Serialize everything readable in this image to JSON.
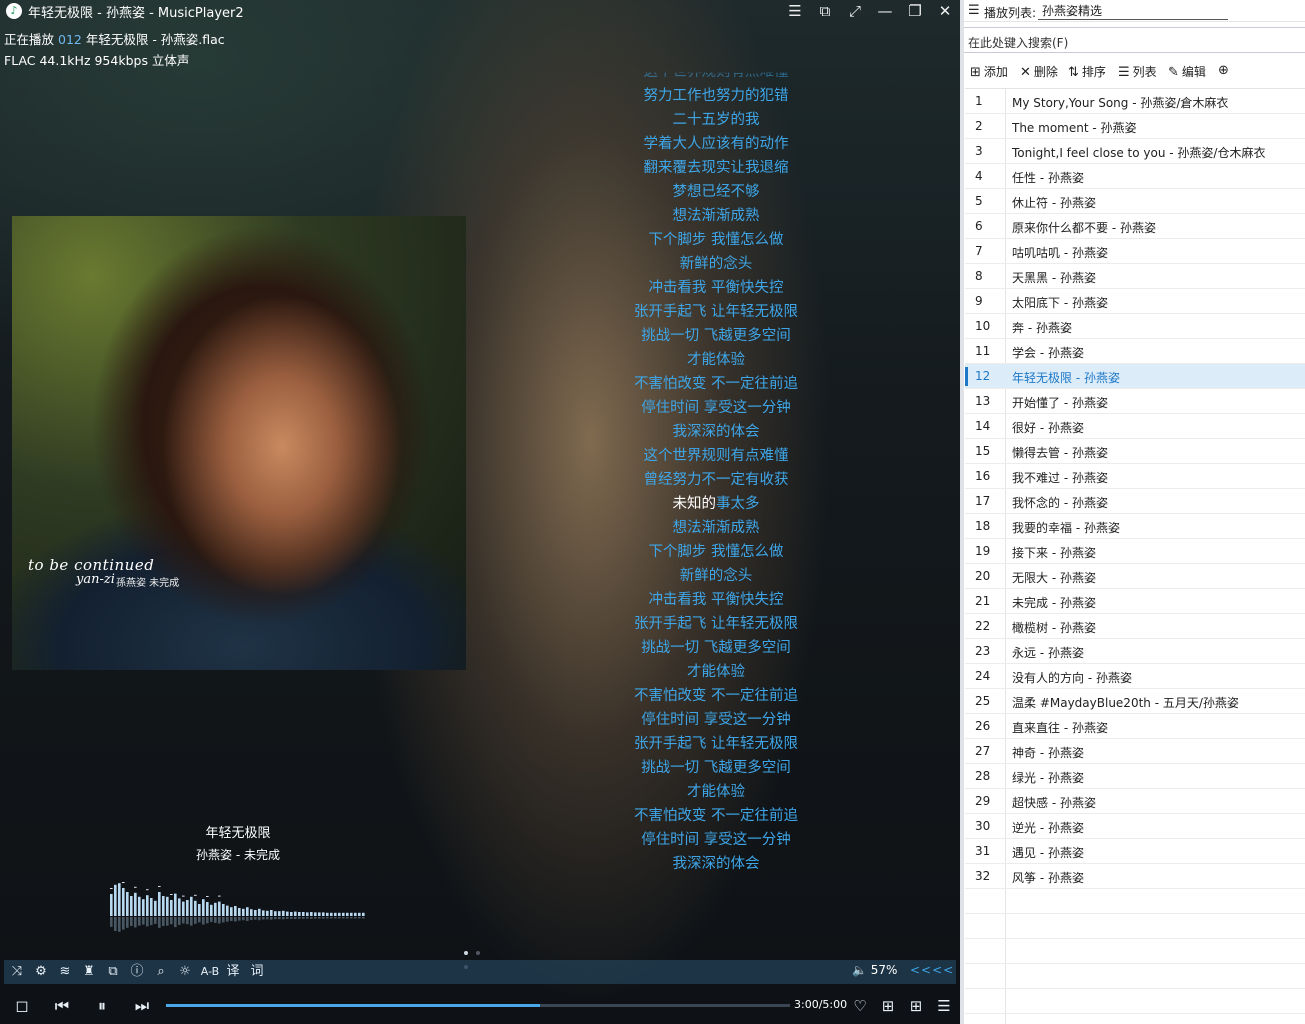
{
  "window": {
    "title": "年轻无极限 - 孙燕姿 - MusicPlayer2",
    "app_icon": "music-note-icon",
    "buttons": [
      "menu-icon",
      "mini-mode-icon",
      "fullscreen-icon",
      "minimize-icon",
      "restore-icon",
      "close-icon"
    ]
  },
  "now_playing": {
    "prefix": "正在播放",
    "index": "012",
    "file": "年轻无极限 - 孙燕姿.flac",
    "format": "FLAC 44.1kHz 954kbps 立体声",
    "title": "年轻无极限",
    "artist_album": "孙燕姿 - 未完成"
  },
  "cover": {
    "text_line1": "to be continued",
    "text_line2": "yan-zi",
    "text_line3": "孫燕姿 未完成"
  },
  "lyrics": {
    "lines": [
      "努力工作也努力的犯错",
      "二十五岁的我",
      "学着大人应该有的动作",
      "翻来覆去现实让我退缩",
      "梦想已经不够",
      "想法渐渐成熟",
      "下个脚步 我懂怎么做",
      "新鲜的念头",
      "冲击看我 平衡快失控",
      "张开手起飞 让年轻无极限",
      "挑战一切 飞越更多空间",
      "才能体验",
      "不害怕改变 不一定往前追",
      "停住时间 享受这一分钟",
      "我深深的体会",
      "这个世界规则有点难懂",
      "曾经努力不一定有收获",
      "未知的事太多",
      "想法渐渐成熟",
      "下个脚步 我懂怎么做",
      "新鲜的念头",
      "冲击看我 平衡快失控",
      "张开手起飞 让年轻无极限",
      "挑战一切 飞越更多空间",
      "才能体验",
      "不害怕改变 不一定往前追",
      "停住时间 享受这一分钟",
      "张开手起飞 让年轻无极限",
      "挑战一切 飞越更多空间",
      "才能体验",
      "不害怕改变 不一定往前追",
      "停住时间 享受这一分钟",
      "我深深的体会"
    ],
    "current_line_index": 17,
    "current_sung": "未知的",
    "current_rest": "事太多",
    "highlight_color": "#3ea6e8"
  },
  "spectrum": {
    "levels": [
      0.55,
      0.78,
      0.82,
      0.7,
      0.6,
      0.5,
      0.58,
      0.48,
      0.42,
      0.52,
      0.45,
      0.38,
      0.6,
      0.5,
      0.48,
      0.4,
      0.56,
      0.44,
      0.36,
      0.4,
      0.48,
      0.38,
      0.3,
      0.42,
      0.35,
      0.28,
      0.33,
      0.36,
      0.3,
      0.26,
      0.22,
      0.25,
      0.2,
      0.18,
      0.22,
      0.17,
      0.15,
      0.18,
      0.14,
      0.13,
      0.15,
      0.12,
      0.12,
      0.13,
      0.11,
      0.1,
      0.11,
      0.1,
      0.1,
      0.09,
      0.1,
      0.09,
      0.09,
      0.09,
      0.08,
      0.08,
      0.08,
      0.08,
      0.08,
      0.08,
      0.08,
      0.08,
      0.08,
      0.08
    ]
  },
  "page_dots": {
    "count": 3,
    "active": 0
  },
  "toolbar": {
    "icons": [
      "shuffle-icon",
      "settings-icon",
      "equalizer-icon",
      "skin-icon",
      "mini-icon",
      "info-icon",
      "search-icon",
      "brightness-icon"
    ],
    "ab_label": "A-B",
    "translate_label": "译",
    "lyrics_label": "词",
    "volume_icon": "speaker-icon",
    "volume": "57%",
    "arrows": "<<<<"
  },
  "controls": {
    "icons": [
      "stop-icon",
      "previous-icon",
      "pause-icon",
      "next-icon"
    ],
    "time": "3:00/5:00",
    "progress": 0.6,
    "right_icons": [
      "favorite-icon",
      "add-to-playlist-icon",
      "grid-icon",
      "playlist-icon"
    ]
  },
  "playlist": {
    "label": "播放列表:",
    "name": "孙燕姿精选",
    "search_placeholder": "在此处键入搜索(F)",
    "toolbar": {
      "add": "添加",
      "delete": "删除",
      "sort": "排序",
      "list": "列表",
      "edit": "编辑"
    },
    "selected_index": 11,
    "items": [
      {
        "n": "1",
        "t": "My Story,Your Song - 孙燕姿/倉木麻衣"
      },
      {
        "n": "2",
        "t": "The moment - 孙燕姿"
      },
      {
        "n": "3",
        "t": "Tonight,I feel close to you - 孙燕姿/仓木麻衣"
      },
      {
        "n": "4",
        "t": "任性 - 孙燕姿"
      },
      {
        "n": "5",
        "t": "休止符 - 孙燕姿"
      },
      {
        "n": "6",
        "t": "原来你什么都不要 - 孙燕姿"
      },
      {
        "n": "7",
        "t": "咕叽咕叽 - 孙燕姿"
      },
      {
        "n": "8",
        "t": "天黑黑 - 孙燕姿"
      },
      {
        "n": "9",
        "t": "太阳底下 - 孙燕姿"
      },
      {
        "n": "10",
        "t": "奔 - 孙燕姿"
      },
      {
        "n": "11",
        "t": "学会 - 孙燕姿"
      },
      {
        "n": "12",
        "t": "年轻无极限 - 孙燕姿"
      },
      {
        "n": "13",
        "t": "开始懂了 - 孙燕姿"
      },
      {
        "n": "14",
        "t": "很好 - 孙燕姿"
      },
      {
        "n": "15",
        "t": "懒得去管 - 孙燕姿"
      },
      {
        "n": "16",
        "t": "我不难过 - 孙燕姿"
      },
      {
        "n": "17",
        "t": "我怀念的 - 孙燕姿"
      },
      {
        "n": "18",
        "t": "我要的幸福 - 孙燕姿"
      },
      {
        "n": "19",
        "t": "接下来 - 孙燕姿"
      },
      {
        "n": "20",
        "t": "无限大 - 孙燕姿"
      },
      {
        "n": "21",
        "t": "未完成 - 孙燕姿"
      },
      {
        "n": "22",
        "t": "橄榄树 - 孙燕姿"
      },
      {
        "n": "23",
        "t": "永远 - 孙燕姿"
      },
      {
        "n": "24",
        "t": "没有人的方向 - 孙燕姿"
      },
      {
        "n": "25",
        "t": "温柔 #MaydayBlue20th - 五月天/孙燕姿"
      },
      {
        "n": "26",
        "t": "直来直往 - 孙燕姿"
      },
      {
        "n": "27",
        "t": "神奇 - 孙燕姿"
      },
      {
        "n": "28",
        "t": "绿光 - 孙燕姿"
      },
      {
        "n": "29",
        "t": "超快感 - 孙燕姿"
      },
      {
        "n": "30",
        "t": "逆光 - 孙燕姿"
      },
      {
        "n": "31",
        "t": "遇见 - 孙燕姿"
      },
      {
        "n": "32",
        "t": "风筝 - 孙燕姿"
      }
    ]
  },
  "colors": {
    "accent": "#3ea6e8",
    "selection": "#dcecf8",
    "selection_text": "#1e78c8"
  }
}
